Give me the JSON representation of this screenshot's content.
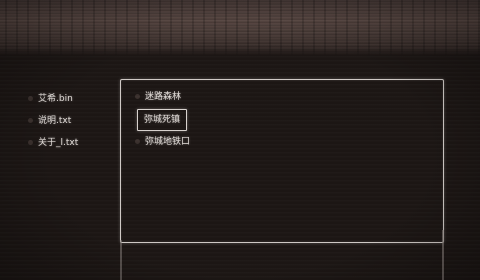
{
  "sidebar": {
    "files": [
      {
        "label": "艾希.bin"
      },
      {
        "label": "说明.txt"
      },
      {
        "label": "关于_l.txt"
      }
    ]
  },
  "panel": {
    "choices": [
      {
        "label": "迷路森林",
        "selected": false
      },
      {
        "label": "弥城死镇",
        "selected": true
      },
      {
        "label": "弥城地铁口",
        "selected": false
      }
    ]
  }
}
